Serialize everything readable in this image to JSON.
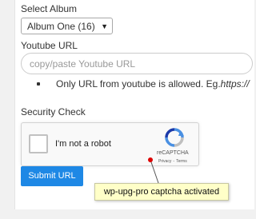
{
  "form": {
    "album_label": "Select Album",
    "album_selected": "Album One  (16)",
    "youtube_label": "Youtube URL",
    "youtube_placeholder": "copy/paste Youtube URL",
    "youtube_value": "",
    "hint_text": "Only URL from youtube is allowed. Eg.",
    "hint_example": "https://",
    "security_label": "Security Check",
    "submit_label": "Submit URL"
  },
  "captcha": {
    "checkbox_label": "I'm not a robot",
    "checked": false,
    "brand": "reCAPTCHA",
    "privacy_link": "Privacy",
    "terms_link": "Terms"
  },
  "annotation": {
    "callout_text": "wp-upg-pro captcha activated",
    "marker_color": "#dd0000"
  },
  "colors": {
    "submit_button": "#1e88e5",
    "callout_background": "#ffffc8",
    "captcha_logo_blue": "#4a90e2",
    "captcha_logo_grey": "#bfbfbf"
  },
  "icons": {
    "select_caret": "caret-down-icon",
    "captcha_logo": "recaptcha-logo-icon"
  }
}
